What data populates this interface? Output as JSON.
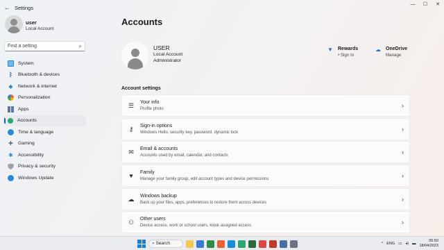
{
  "window": {
    "title": "Settings",
    "back_glyph": "←",
    "controls": [
      "—",
      "☐",
      "✕"
    ]
  },
  "user": {
    "name": "user",
    "type": "Local Account"
  },
  "search": {
    "placeholder": "Find a setting"
  },
  "sidebar": {
    "items": [
      {
        "label": "System",
        "icon": "system-icon"
      },
      {
        "label": "Bluetooth & devices",
        "icon": "bluetooth-icon"
      },
      {
        "label": "Network & internet",
        "icon": "wifi-icon"
      },
      {
        "label": "Personalization",
        "icon": "brush-icon"
      },
      {
        "label": "Apps",
        "icon": "apps-icon"
      },
      {
        "label": "Accounts",
        "icon": "account-icon",
        "active": true
      },
      {
        "label": "Time & language",
        "icon": "globe-clock-icon"
      },
      {
        "label": "Gaming",
        "icon": "gamepad-icon"
      },
      {
        "label": "Accessibility",
        "icon": "accessibility-icon"
      },
      {
        "label": "Privacy & security",
        "icon": "shield-icon"
      },
      {
        "label": "Windows Update",
        "icon": "update-icon"
      }
    ]
  },
  "main": {
    "title": "Accounts",
    "account": {
      "name": "USER",
      "type": "Local Account",
      "role": "Administrator"
    },
    "rewards": {
      "title": "Rewards",
      "sub": "• Sign In"
    },
    "onedrive": {
      "title": "OneDrive",
      "sub": "Manage"
    },
    "section_title": "Account settings",
    "settings": [
      {
        "title": "Your info",
        "sub": "Profile photo",
        "icon": "person-info-icon"
      },
      {
        "title": "Sign-in options",
        "sub": "Windows Hello, security key, password, dynamic lock",
        "icon": "key-icon"
      },
      {
        "title": "Email & accounts",
        "sub": "Accounts used by email, calendar, and contacts",
        "icon": "email-icon"
      },
      {
        "title": "Family",
        "sub": "Manage your family group, edit account types and device permissions",
        "icon": "heart-icon"
      },
      {
        "title": "Windows backup",
        "sub": "Back up your files, apps, preferences to restore them across devices",
        "icon": "backup-icon"
      },
      {
        "title": "Other users",
        "sub": "Device access, work or school users, kiosk assigned access",
        "icon": "add-user-icon"
      }
    ]
  },
  "taskbar": {
    "search_label": "Search",
    "language": "ENG",
    "time": "05:50",
    "date": "18/04/2023",
    "app_colors": [
      "#f2c94c",
      "#3a7bd5",
      "#2f8a4e",
      "#e8623a",
      "#1a8bd6",
      "#2aa86d",
      "#2a6d3d",
      "#d94848",
      "#c0392b",
      "#4a6fa5",
      "#6b7380"
    ]
  },
  "colors": {
    "accent": "#0067c0"
  }
}
